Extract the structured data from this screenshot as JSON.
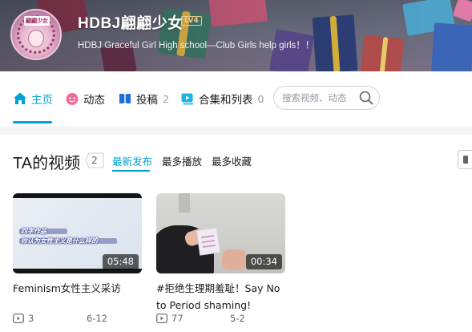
{
  "banner": {
    "username": "HDBJ翩翩少女",
    "level": "LV4",
    "signature": "HDBJ Graceful Girl High school—Club Girls help girls！！",
    "avatar_text": "翩翩少女"
  },
  "nav": {
    "items": [
      {
        "label": "主页",
        "count": null,
        "icon": "home-icon",
        "active": true
      },
      {
        "label": "动态",
        "count": null,
        "icon": "dynamic-icon",
        "active": false
      },
      {
        "label": "投稿",
        "count": "2",
        "icon": "upload-icon",
        "active": false
      },
      {
        "label": "合集和列表",
        "count": "0",
        "icon": "playlist-icon",
        "active": false
      }
    ],
    "search_placeholder": "搜索视频、动态"
  },
  "videos": {
    "title": "TA的视频",
    "count": "2",
    "sort_tabs": [
      "最新发布",
      "最多播放",
      "最多收藏"
    ],
    "active_sort": "最新发布",
    "items": [
      {
        "duration": "05:48",
        "title": "Feminism女性主义采访",
        "plays": "3",
        "date": "6-12",
        "thumb_caption_1": "四字作品",
        "thumb_caption_2": "你认为女性主义是什么样的"
      },
      {
        "duration": "00:34",
        "title": "#拒绝生理期羞耻！Say No to Period shaming!",
        "plays": "77",
        "date": "5-2"
      }
    ]
  },
  "colors": {
    "accent": "#00a1d6",
    "text_primary": "#18191c",
    "text_secondary": "#61666d",
    "muted": "#9499a0",
    "level_badge": "#f3c98a"
  }
}
